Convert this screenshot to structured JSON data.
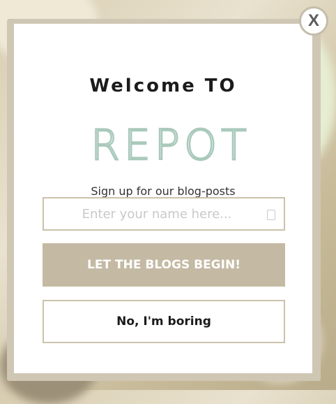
{
  "popup": {
    "close_label": "X",
    "title": "Welcome TO",
    "logo_text": "REPOT",
    "subtitle": "Sign up for our blog-posts",
    "name_placeholder": "Enter your name here...",
    "cta_label": "LET THE BLOGS BEGIN!",
    "decline_label": "No, I'm boring"
  },
  "colors": {
    "logo": "#a9c9bb",
    "cta_background": "#c4b9a3",
    "border": "#cbc2ab"
  },
  "icons": {
    "name_field_icon": "person-icon"
  }
}
